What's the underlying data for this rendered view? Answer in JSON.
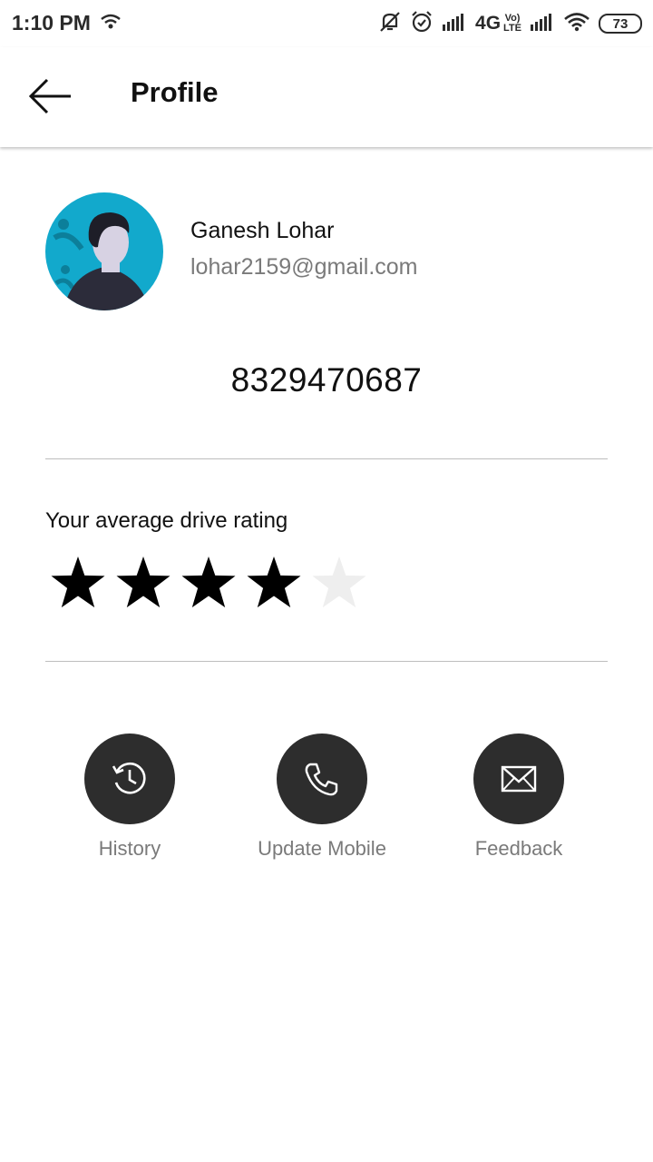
{
  "status_bar": {
    "time": "1:10 PM",
    "network": "4G",
    "network_sub": "1",
    "volte_top": "Vo)",
    "volte_bottom": "LTE",
    "battery": "73"
  },
  "header": {
    "title": "Profile",
    "back_icon": "arrow-left-icon"
  },
  "profile": {
    "name": "Ganesh Lohar",
    "email": "lohar2159@gmail.com",
    "phone": "8329470687"
  },
  "rating": {
    "label": "Your average drive rating",
    "value": 4,
    "max": 5,
    "filled_color": "#000000",
    "empty_color": "#eeeeee"
  },
  "actions": [
    {
      "label": "History",
      "icon": "history-icon"
    },
    {
      "label": "Update Mobile",
      "icon": "phone-icon"
    },
    {
      "label": "Feedback",
      "icon": "envelope-icon"
    }
  ],
  "colors": {
    "action_circle": "#2d2d2d",
    "avatar_bg": "#12a9cc",
    "muted_text": "#7a7a7a"
  }
}
